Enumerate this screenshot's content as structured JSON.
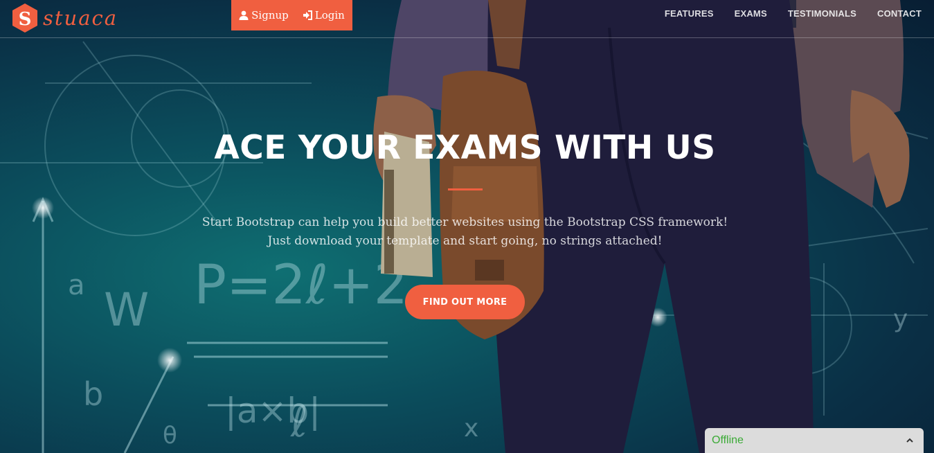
{
  "brand": {
    "logo_letter": "S",
    "name": "stuaca",
    "accent_color": "#f05f40"
  },
  "auth": {
    "signup_label": "Signup",
    "signup_icon": "user-icon",
    "login_label": "Login",
    "login_icon": "sign-in-icon"
  },
  "nav": {
    "items": [
      {
        "label": "FEATURES"
      },
      {
        "label": "EXAMS"
      },
      {
        "label": "TESTIMONIALS"
      },
      {
        "label": "CONTACT"
      }
    ]
  },
  "hero": {
    "title": "ACE YOUR EXAMS WITH US",
    "text_line1": "Start Bootstrap can help you build better websites using the Bootstrap CSS framework!",
    "text_line2": "Just download your template and start going, no strings attached!",
    "button_label": "FIND OUT MORE"
  },
  "chat": {
    "status": "Offline",
    "toggle_icon": "chevron-up-icon",
    "status_color": "#3aaa35"
  },
  "background": {
    "formula_1": "P=2ℓ+2",
    "formula_2": "|a×b|",
    "letter_a": "a",
    "letter_b": "b",
    "letter_w": "W",
    "letter_x": "x",
    "letter_y": "y",
    "letter_theta": "θ",
    "letter_l": "ℓ"
  }
}
